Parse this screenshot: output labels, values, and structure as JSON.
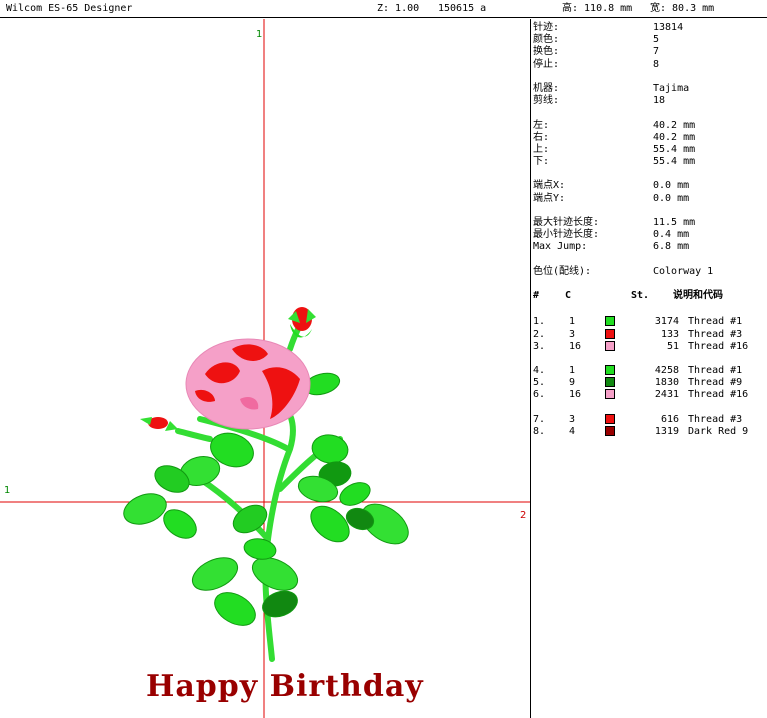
{
  "titlebar": {
    "app": "Wilcom ES-65 Designer",
    "zoom": "Z: 1.00",
    "code": "150615 a",
    "height": "高: 110.8 mm",
    "width": "宽: 80.3 mm"
  },
  "canvas": {
    "axis_marks": {
      "top": "1",
      "left": "1",
      "right": "2"
    },
    "text": "Happy Birthday"
  },
  "info": {
    "stats": [
      {
        "label": "针迹:",
        "value": "13814"
      },
      {
        "label": "颜色:",
        "value": "5"
      },
      {
        "label": "换色:",
        "value": "7"
      },
      {
        "label": "停止:",
        "value": "8"
      }
    ],
    "machine": [
      {
        "label": "机器:",
        "value": "Tajima"
      },
      {
        "label": "剪线:",
        "value": "18"
      }
    ],
    "extents": [
      {
        "label": "左:",
        "value": "40.2 mm"
      },
      {
        "label": "右:",
        "value": "40.2 mm"
      },
      {
        "label": "上:",
        "value": "55.4 mm"
      },
      {
        "label": "下:",
        "value": "55.4 mm"
      }
    ],
    "endpoint": [
      {
        "label": "端点X:",
        "value": "0.0 mm"
      },
      {
        "label": "端点Y:",
        "value": "0.0 mm"
      }
    ],
    "lengths": [
      {
        "label": "最大针迹长度:",
        "value": "11.5 mm"
      },
      {
        "label": "最小针迹长度:",
        "value": "0.4 mm"
      },
      {
        "label": "Max Jump:",
        "value": "6.8 mm"
      }
    ],
    "colorway": {
      "label": "色位(配线):",
      "value": "Colorway 1"
    }
  },
  "table": {
    "headers": {
      "num": "#",
      "c": "C",
      "st": "St.",
      "desc": "说明和代码"
    },
    "groups": [
      [
        {
          "num": "1.",
          "c": "1",
          "color": "#22dd22",
          "st": "3174",
          "desc": "Thread #1"
        },
        {
          "num": "2.",
          "c": "3",
          "color": "#ee1111",
          "st": "133",
          "desc": "Thread #3"
        },
        {
          "num": "3.",
          "c": "16",
          "color": "#f5a0c8",
          "st": "51",
          "desc": "Thread #16"
        }
      ],
      [
        {
          "num": "4.",
          "c": "1",
          "color": "#22dd22",
          "st": "4258",
          "desc": "Thread #1"
        },
        {
          "num": "5.",
          "c": "9",
          "color": "#118811",
          "st": "1830",
          "desc": "Thread #9"
        },
        {
          "num": "6.",
          "c": "16",
          "color": "#f5a0c8",
          "st": "2431",
          "desc": "Thread #16"
        }
      ],
      [
        {
          "num": "7.",
          "c": "3",
          "color": "#ee1111",
          "st": "616",
          "desc": "Thread #3"
        },
        {
          "num": "8.",
          "c": "4",
          "color": "#990000",
          "st": "1319",
          "desc": "Dark Red 9"
        }
      ]
    ]
  }
}
